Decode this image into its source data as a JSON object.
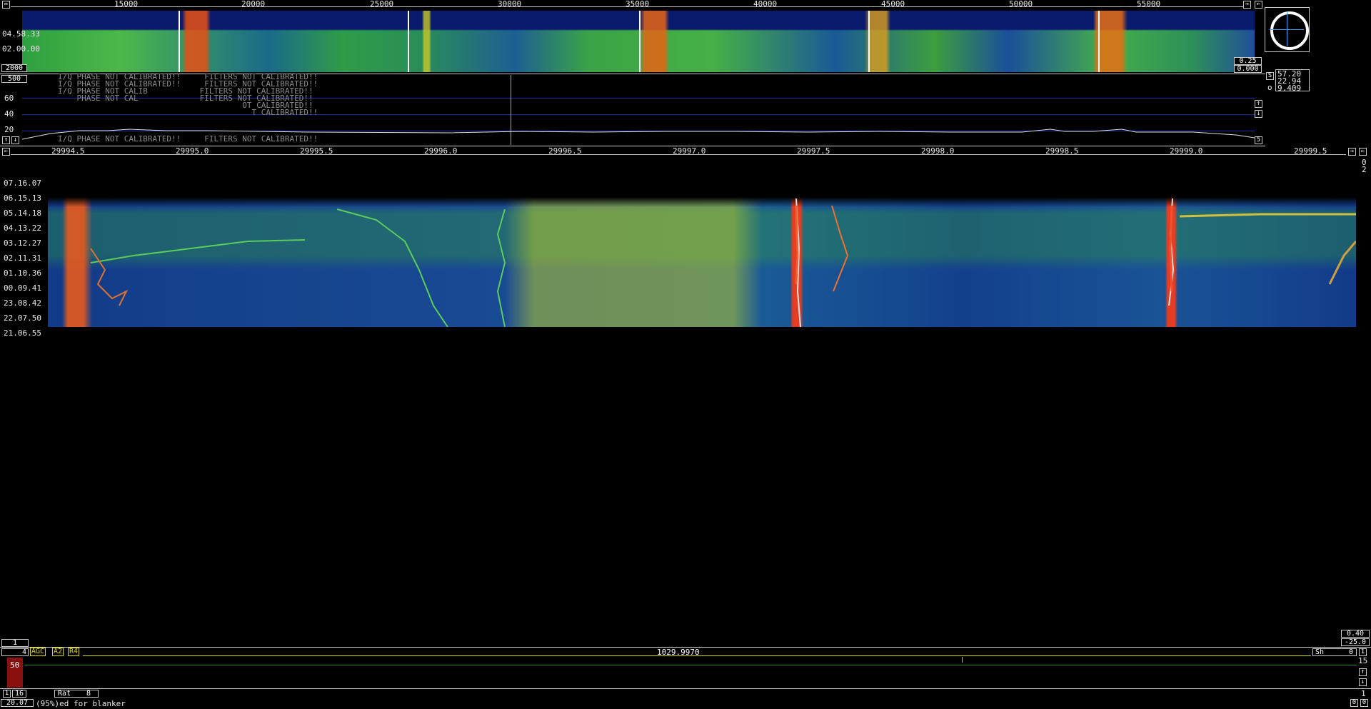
{
  "top_axis": {
    "labels": [
      "15000",
      "20000",
      "25000",
      "30000",
      "35000",
      "40000",
      "45000",
      "50000",
      "55000"
    ]
  },
  "top_waterfall": {
    "time_labels": [
      "04.58.33",
      "02.00.00"
    ],
    "left_bottom": "2000",
    "right_values": [
      "0.25",
      "0.000"
    ]
  },
  "spectrum": {
    "scale_top": "500",
    "y_labels": [
      "60",
      "40",
      "20"
    ],
    "messages": [
      "I/Q PHASE NOT CALIBRATED!!     FILTERS NOT CALIBRATED!!",
      "I/Q PHASE NOT CALIBRATED!!     FILTERS NOT CALIBRATED!!",
      "I/Q PHASE NOT CALIB           FILTERS NOT CALIBRATED!!",
      "    PHASE NOT CAL             FILTERS NOT CALIBRATED!!",
      "                                       OT CALIBRATED!!",
      "                                         T CALIBRATED!!",
      "I/Q PHASE NOT CALIBRATED!!     FILTERS NOT CALIBRATED!!"
    ],
    "right_buttons": [
      "S",
      "↑",
      "↓",
      "5"
    ],
    "side_values": [
      "57.20",
      "22.94",
      "9.409"
    ],
    "side_prefix": "o"
  },
  "main_axis": {
    "labels": [
      "29994.5",
      "29995.0",
      "29995.5",
      "29996.0",
      "29996.5",
      "29997.0",
      "29997.5",
      "29998.0",
      "29998.5",
      "29999.0",
      "29999.5"
    ],
    "right_digits": [
      "0",
      "2"
    ]
  },
  "main_waterfall": {
    "time_labels": [
      "07.16.07",
      "06.15.13",
      "05.14.18",
      "04.13.22",
      "03.12.27",
      "02.11.31",
      "01.10.36",
      "00.09.41",
      "23.08.42",
      "22.07.50",
      "21.06.55"
    ],
    "bottom_left": "1",
    "right_values": [
      "0.40",
      "-25.0"
    ]
  },
  "bottom_bar": {
    "left_num": "4",
    "agc": "AGC",
    "a2": "A2",
    "r4": "R4",
    "frequency": "1029.9970",
    "sh_label": "Sh",
    "sh_value": "0",
    "right_num": "1",
    "level": "50",
    "right_value": "15",
    "bottom_right": "1"
  },
  "status": {
    "b1": "1",
    "b2": "16",
    "rat_label": "Rat",
    "rat_value": "8",
    "left_value": "20.07",
    "message": "(95%)ed for blanker",
    "btn_left": "0",
    "btn_right": "0"
  },
  "colors": {
    "background": "#000000",
    "axis": "#c8c8c8",
    "accent_yellow": "#d9d300",
    "waterfall_blue": "#0c2a8c",
    "signal_green": "#3fc43f",
    "signal_red": "#e8402a"
  }
}
